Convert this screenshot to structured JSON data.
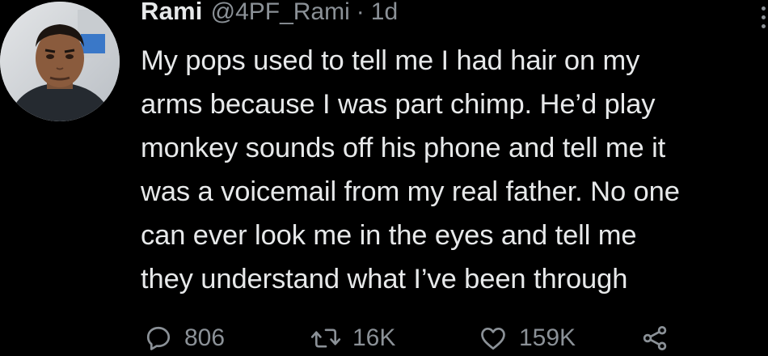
{
  "author": {
    "display_name": "Rami",
    "handle": "@4PF_Rami",
    "separator": "·",
    "time": "1d",
    "avatar": "profile-photo"
  },
  "tweet": {
    "lines": [
      "My pops used to tell me I had hair on my",
      "arms because I was part chimp. He’d play",
      "monkey sounds off his phone and tell me it",
      "was a voicemail from my real father. No one",
      "can ever look me in the eyes and tell me",
      "they understand what I’ve been through"
    ]
  },
  "actions": {
    "reply": {
      "icon": "reply-icon",
      "count": "806"
    },
    "retweet": {
      "icon": "retweet-icon",
      "count": "16K"
    },
    "like": {
      "icon": "heart-icon",
      "count": "159K"
    },
    "share": {
      "icon": "share-icon"
    }
  },
  "colors": {
    "background": "#000000",
    "text": "#e7e9ea",
    "muted": "#8b9197"
  }
}
